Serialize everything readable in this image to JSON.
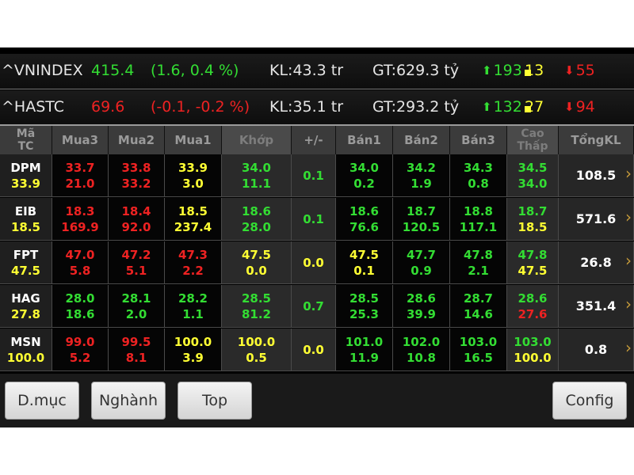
{
  "indices": [
    {
      "name": "^VNINDEX",
      "value": "415.4",
      "change": "(1.6, 0.4 %)",
      "change_color": "green",
      "kl": "KL:43.3 tr",
      "gt": "GT:629.3 tỷ",
      "up": "193",
      "flat": "13",
      "down": "55"
    },
    {
      "name": "^HASTC",
      "value": "69.6",
      "change": "(-0.1, -0.2 %)",
      "change_color": "red",
      "kl": "KL:35.1 tr",
      "gt": "GT:293.2 tỷ",
      "up": "132",
      "flat": "27",
      "down": "94"
    }
  ],
  "columns": [
    {
      "label": "Mã\nTC"
    },
    {
      "label": "Mua3"
    },
    {
      "label": "Mua2"
    },
    {
      "label": "Mua1"
    },
    {
      "label": "Khớp"
    },
    {
      "label": "+/-"
    },
    {
      "label": "Bán1"
    },
    {
      "label": "Bán2"
    },
    {
      "label": "Bán3"
    },
    {
      "label": "Cao\nThấp"
    },
    {
      "label": "TổngKL"
    }
  ],
  "rows": [
    {
      "symbol": "DPM",
      "ref": "33.9",
      "cells": [
        [
          "33.7",
          "21.0",
          "red",
          "red"
        ],
        [
          "33.8",
          "33.2",
          "red",
          "red"
        ],
        [
          "33.9",
          "3.0",
          "yellow",
          "yellow"
        ],
        [
          "34.0",
          "11.1",
          "green",
          "green"
        ],
        [
          "0.1",
          "",
          "green",
          ""
        ],
        [
          "34.0",
          "0.2",
          "green",
          "green"
        ],
        [
          "34.2",
          "1.9",
          "green",
          "green"
        ],
        [
          "34.3",
          "0.8",
          "green",
          "green"
        ],
        [
          "34.5",
          "34.0",
          "green",
          "green"
        ]
      ],
      "total": "108.5"
    },
    {
      "symbol": "EIB",
      "ref": "18.5",
      "cells": [
        [
          "18.3",
          "169.9",
          "red",
          "red"
        ],
        [
          "18.4",
          "92.0",
          "red",
          "red"
        ],
        [
          "18.5",
          "237.4",
          "yellow",
          "yellow"
        ],
        [
          "18.6",
          "28.0",
          "green",
          "green"
        ],
        [
          "0.1",
          "",
          "green",
          ""
        ],
        [
          "18.6",
          "76.6",
          "green",
          "green"
        ],
        [
          "18.7",
          "120.5",
          "green",
          "green"
        ],
        [
          "18.8",
          "117.1",
          "green",
          "green"
        ],
        [
          "18.7",
          "18.5",
          "green",
          "yellow"
        ]
      ],
      "total": "571.6"
    },
    {
      "symbol": "FPT",
      "ref": "47.5",
      "cells": [
        [
          "47.0",
          "5.8",
          "red",
          "red"
        ],
        [
          "47.2",
          "5.1",
          "red",
          "red"
        ],
        [
          "47.3",
          "2.2",
          "red",
          "red"
        ],
        [
          "47.5",
          "0.0",
          "yellow",
          "yellow"
        ],
        [
          "0.0",
          "",
          "yellow",
          ""
        ],
        [
          "47.5",
          "0.1",
          "yellow",
          "yellow"
        ],
        [
          "47.7",
          "0.9",
          "green",
          "green"
        ],
        [
          "47.8",
          "2.1",
          "green",
          "green"
        ],
        [
          "47.8",
          "47.5",
          "green",
          "yellow"
        ]
      ],
      "total": "26.8"
    },
    {
      "symbol": "HAG",
      "ref": "27.8",
      "cells": [
        [
          "28.0",
          "18.6",
          "green",
          "green"
        ],
        [
          "28.1",
          "2.0",
          "green",
          "green"
        ],
        [
          "28.2",
          "1.1",
          "green",
          "green"
        ],
        [
          "28.5",
          "81.2",
          "green",
          "green"
        ],
        [
          "0.7",
          "",
          "green",
          ""
        ],
        [
          "28.5",
          "25.3",
          "green",
          "green"
        ],
        [
          "28.6",
          "39.9",
          "green",
          "green"
        ],
        [
          "28.7",
          "14.6",
          "green",
          "green"
        ],
        [
          "28.6",
          "27.6",
          "green",
          "red"
        ]
      ],
      "total": "351.4"
    },
    {
      "symbol": "MSN",
      "ref": "100.0",
      "cells": [
        [
          "99.0",
          "5.2",
          "red",
          "red"
        ],
        [
          "99.5",
          "8.1",
          "red",
          "red"
        ],
        [
          "100.0",
          "3.9",
          "yellow",
          "yellow"
        ],
        [
          "100.0",
          "0.5",
          "yellow",
          "yellow"
        ],
        [
          "0.0",
          "",
          "yellow",
          ""
        ],
        [
          "101.0",
          "11.9",
          "green",
          "green"
        ],
        [
          "102.0",
          "10.8",
          "green",
          "green"
        ],
        [
          "103.0",
          "16.5",
          "green",
          "green"
        ],
        [
          "103.0",
          "100.0",
          "green",
          "yellow"
        ]
      ],
      "total": "0.8"
    }
  ],
  "buttons": {
    "category": "D.mục",
    "sector": "Nghành",
    "top": "Top",
    "config": "Config"
  },
  "colors": {
    "green": "#33dd33",
    "red": "#ee2222",
    "yellow": "#ffff33",
    "background": "#000000"
  }
}
